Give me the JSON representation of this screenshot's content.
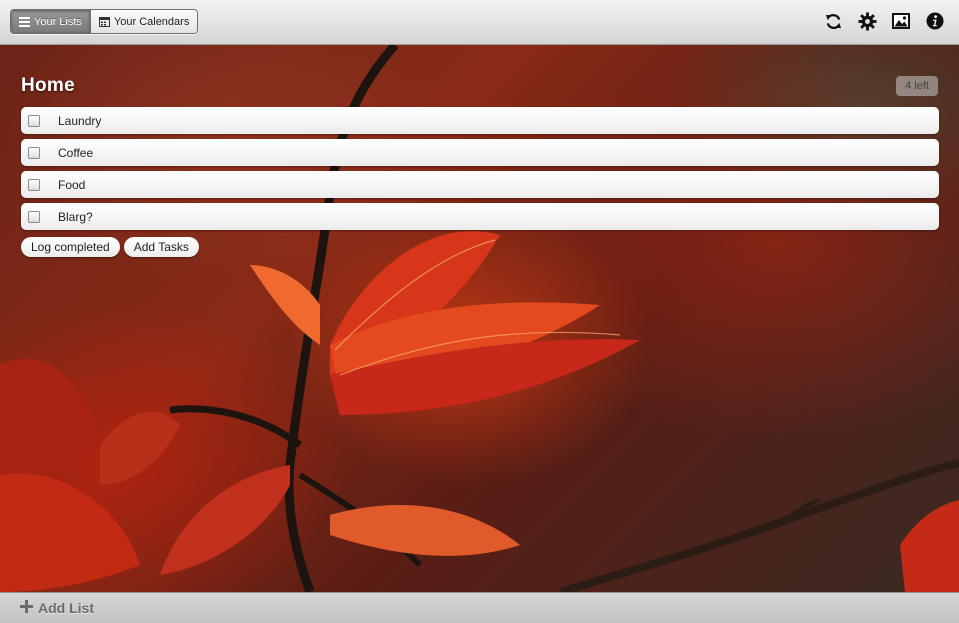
{
  "toolbar": {
    "tabs": [
      {
        "label": "Your Lists",
        "icon": "list-icon",
        "active": true
      },
      {
        "label": "Your Calendars",
        "icon": "calendar-icon",
        "active": false
      }
    ],
    "icons": [
      "sync-icon",
      "gear-icon",
      "image-icon",
      "info-icon"
    ]
  },
  "list": {
    "title": "Home",
    "left_badge": "4 left",
    "tasks": [
      {
        "label": "Laundry",
        "checked": false
      },
      {
        "label": "Coffee",
        "checked": false
      },
      {
        "label": "Food",
        "checked": false
      },
      {
        "label": "Blarg?",
        "checked": false
      }
    ],
    "actions": {
      "log_completed": "Log completed",
      "add_tasks": "Add Tasks"
    }
  },
  "footer": {
    "add_list": "Add List"
  },
  "colors": {
    "toolbar_bg": "#d4d4d4",
    "active_tab": "#7a7a7a",
    "badge_text": "#444444",
    "footer_text": "#6a6a6a"
  }
}
